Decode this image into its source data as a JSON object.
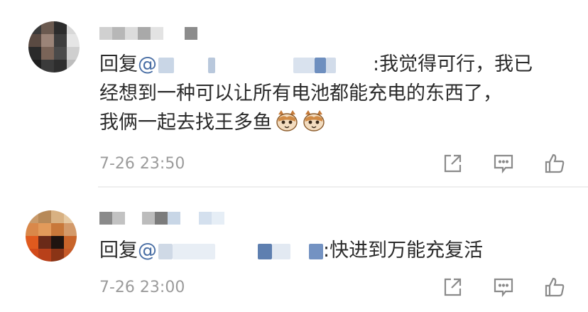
{
  "comments": [
    {
      "reply_prefix": "回复",
      "mention_at": "@",
      "lines": [
        ":我觉得可行，我已",
        "经想到一种可以让所有电池都能充电的东西了，",
        "我俩一起去找王多鱼"
      ],
      "emojis": [
        "cat-face-icon",
        "cat-face-icon"
      ],
      "timestamp": "7-26 23:50"
    },
    {
      "reply_prefix": "回复",
      "mention_at": "@",
      "lines": [
        ":快进到万能充复活"
      ],
      "timestamp": "7-26 23:00"
    }
  ],
  "actions": [
    "share-icon",
    "comment-icon",
    "like-icon"
  ],
  "colors": {
    "mention": "#4a6fa5",
    "text": "#2b2b2b",
    "muted": "#9b9b9b",
    "icon": "#8a8a8a"
  }
}
